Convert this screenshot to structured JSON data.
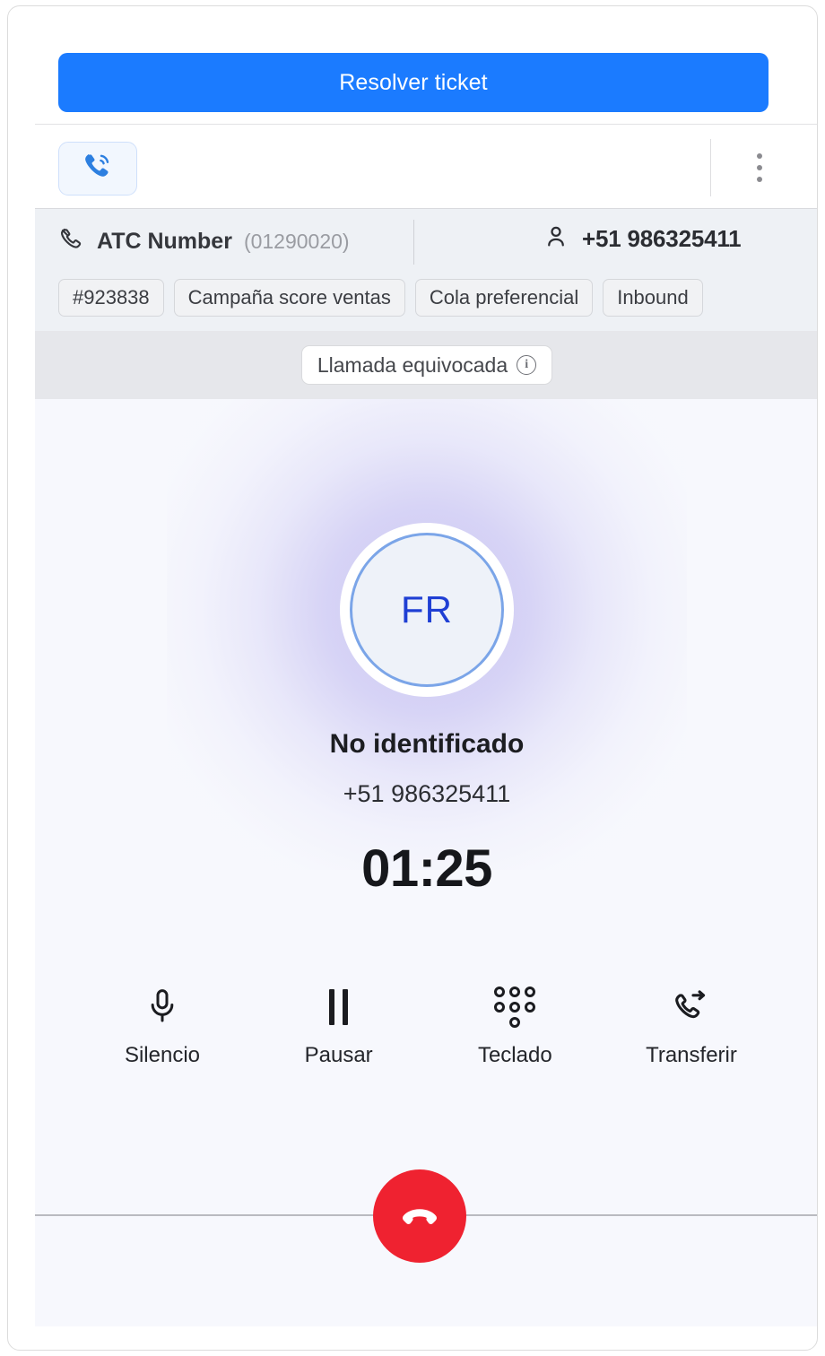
{
  "toolbar": {
    "resolve_label": "Resolver ticket",
    "phone_tab_icon": "phone-ringing-icon",
    "more_menu_icon": "kebab-menu-icon"
  },
  "call_info": {
    "line_icon": "phone-handset-icon",
    "line_label": "ATC Number",
    "line_number": "(01290020)",
    "contact_icon": "person-icon",
    "contact_number": "+51 986325411",
    "tags": [
      {
        "label": "#923838"
      },
      {
        "label": "Campaña score ventas"
      },
      {
        "label": "Cola preferencial"
      },
      {
        "label": "Inbound"
      }
    ]
  },
  "status": {
    "label": "Llamada equivocada",
    "info_icon": "info-circle-icon",
    "info_glyph": "i"
  },
  "call": {
    "avatar_initials": "FR",
    "caller_name": "No identificado",
    "caller_phone": "+51 986325411",
    "duration": "01:25"
  },
  "controls": [
    {
      "label": "Silencio",
      "icon": "microphone-icon"
    },
    {
      "label": "Pausar",
      "icon": "pause-icon"
    },
    {
      "label": "Teclado",
      "icon": "keypad-icon"
    },
    {
      "label": "Transferir",
      "icon": "call-transfer-icon"
    }
  ],
  "hangup": {
    "icon": "hangup-phone-icon"
  },
  "colors": {
    "accent_blue": "#1b7bff",
    "avatar_text": "#1f3fd4",
    "avatar_ring": "#7ba5e8",
    "hangup_red": "#ef2230",
    "stage_bg": "#f7f8fd",
    "info_bg": "#eef1f5",
    "status_bg": "#e6e7eb"
  }
}
